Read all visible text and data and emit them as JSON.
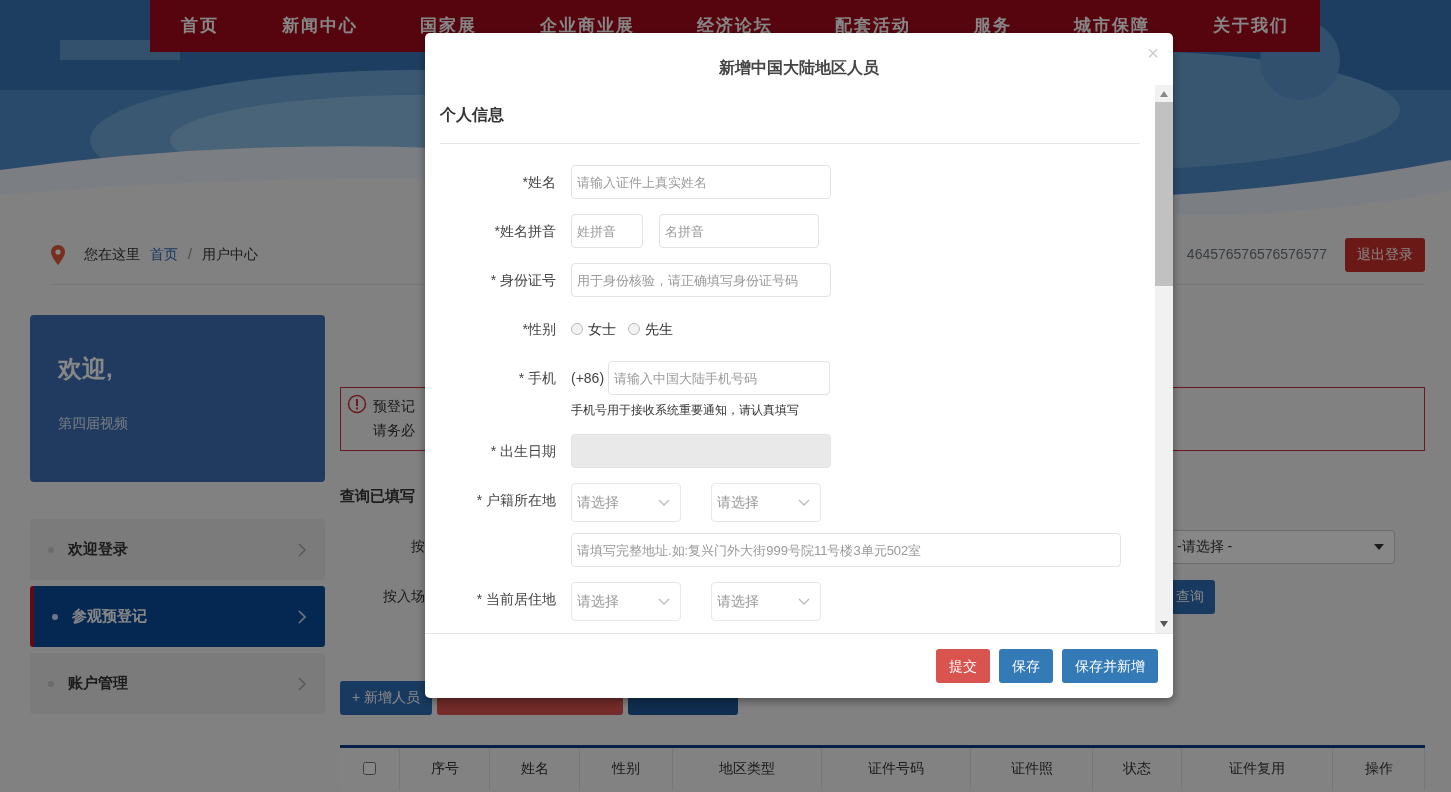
{
  "nav": [
    {
      "label": "首页"
    },
    {
      "label": "新闻中心"
    },
    {
      "label": "国家展"
    },
    {
      "label": "企业商业展"
    },
    {
      "label": "经济论坛"
    },
    {
      "label": "配套活动"
    },
    {
      "label": "服务"
    },
    {
      "label": "城市保障"
    },
    {
      "label": "关于我们"
    }
  ],
  "breadcrumb": {
    "prefix": "您在这里",
    "link": "首页",
    "separator": "/",
    "current": "用户中心"
  },
  "user": {
    "id": "464576576576576577",
    "logout": "退出登录"
  },
  "welcome_card": {
    "title": "欢迎,",
    "subtitle": "第四届视频"
  },
  "sidebar": {
    "items": [
      {
        "label": "欢迎登录",
        "selected": false
      },
      {
        "label": "参观预登记",
        "selected": true
      },
      {
        "label": "账户管理",
        "selected": false
      }
    ]
  },
  "notice": {
    "lines": [
      "预登记",
      "请务必"
    ]
  },
  "query": {
    "title": "查询已填写",
    "filters": [
      {
        "label": "按",
        "select": "-请选择 -"
      },
      {
        "label": "按入场",
        "button": "查询"
      }
    ]
  },
  "actions": [
    {
      "kind": "primary",
      "label": "+ 新增人员"
    },
    {
      "kind": "danger"
    },
    {
      "kind": "dark"
    }
  ],
  "table": {
    "columns": [
      {
        "kind": "checkbox",
        "checked": false
      },
      {
        "label": "序号"
      },
      {
        "label": "姓名"
      },
      {
        "label": "性别"
      },
      {
        "label": "地区类型"
      },
      {
        "label": "证件号码"
      },
      {
        "label": "证件照"
      },
      {
        "label": "状态"
      },
      {
        "label": "证件复用"
      },
      {
        "label": "操作"
      }
    ]
  },
  "modal": {
    "title": "新增中国大陆地区人员",
    "close": "×",
    "section": "个人信息",
    "fields": [
      {
        "kind": "text",
        "label": "*姓名",
        "placeholder": "请输入证件上真实姓名"
      },
      {
        "kind": "pair",
        "label": "*姓名拼音",
        "placeholders": [
          "姓拼音",
          "名拼音"
        ]
      },
      {
        "kind": "text",
        "label": "* 身份证号",
        "placeholder": "用于身份核验，请正确填写身份证号码"
      },
      {
        "kind": "radio",
        "label": "*性别",
        "options": [
          {
            "label": "女士",
            "selected": false
          },
          {
            "label": "先生",
            "selected": false
          }
        ]
      },
      {
        "kind": "phone",
        "label": "* 手机",
        "prefix": "(+86)",
        "placeholder": "请输入中国大陆手机号码",
        "help": "手机号用于接收系统重要通知，请认真填写"
      },
      {
        "kind": "disabled",
        "label": "* 出生日期"
      },
      {
        "kind": "selects",
        "label": "* 户籍所在地",
        "selects": [
          "请选择",
          "请选择"
        ],
        "address_placeholder": "请填写完整地址.如:复兴门外大街999号院11号楼3单元502室"
      },
      {
        "kind": "selects",
        "label": "* 当前居住地",
        "selects": [
          "请选择",
          "请选择"
        ]
      }
    ],
    "buttons": [
      {
        "kind": "danger",
        "label": "提交"
      },
      {
        "kind": "primary",
        "label": "保存"
      },
      {
        "kind": "primary",
        "label": "保存并新增"
      }
    ]
  }
}
